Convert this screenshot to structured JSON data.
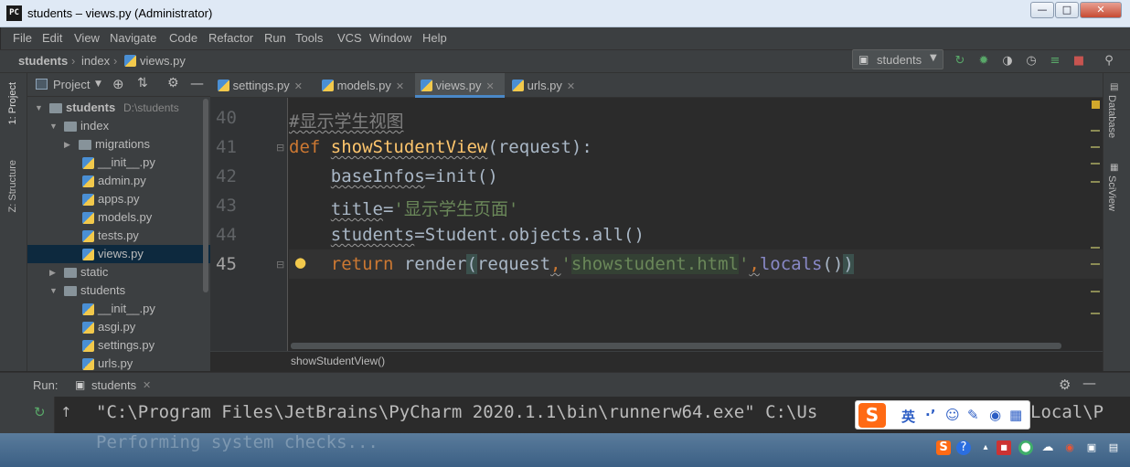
{
  "window": {
    "title": "students – views.py (Administrator)",
    "logo": "PC"
  },
  "menu": [
    "File",
    "Edit",
    "View",
    "Navigate",
    "Code",
    "Refactor",
    "Run",
    "Tools",
    "VCS",
    "Window",
    "Help"
  ],
  "breadcrumbs": [
    "students",
    "index",
    "views.py"
  ],
  "run_config": {
    "label": "students"
  },
  "left_tabs": {
    "project": "1: Project",
    "structure": "Z: Structure"
  },
  "right_tabs": {
    "database": "Database",
    "sciview": "SciView"
  },
  "project_panel": {
    "header": "Project",
    "tree": [
      {
        "label": "students",
        "hint": "D:\\students",
        "depth": 0,
        "type": "folder",
        "open": true
      },
      {
        "label": "index",
        "depth": 1,
        "type": "folder",
        "open": true
      },
      {
        "label": "migrations",
        "depth": 2,
        "type": "folder",
        "open": false
      },
      {
        "label": "__init__.py",
        "depth": 3,
        "type": "py"
      },
      {
        "label": "admin.py",
        "depth": 3,
        "type": "py"
      },
      {
        "label": "apps.py",
        "depth": 3,
        "type": "py"
      },
      {
        "label": "models.py",
        "depth": 3,
        "type": "py"
      },
      {
        "label": "tests.py",
        "depth": 3,
        "type": "py"
      },
      {
        "label": "views.py",
        "depth": 3,
        "type": "py",
        "selected": true
      },
      {
        "label": "static",
        "depth": 1,
        "type": "folder",
        "open": false
      },
      {
        "label": "students",
        "depth": 1,
        "type": "folder",
        "open": true
      },
      {
        "label": "__init__.py",
        "depth": 3,
        "type": "py"
      },
      {
        "label": "asgi.py",
        "depth": 3,
        "type": "py"
      },
      {
        "label": "settings.py",
        "depth": 3,
        "type": "py"
      },
      {
        "label": "urls.py",
        "depth": 3,
        "type": "py"
      }
    ]
  },
  "tabs": [
    {
      "label": "settings.py",
      "active": false
    },
    {
      "label": "models.py",
      "active": false
    },
    {
      "label": "views.py",
      "active": true
    },
    {
      "label": "urls.py",
      "active": false
    }
  ],
  "editor": {
    "line_numbers": [
      "40",
      "41",
      "42",
      "43",
      "44",
      "45"
    ],
    "lines": {
      "l40": {
        "comment": "#显示学生视图"
      },
      "l41": {
        "kw": "def",
        "fn": "showStudentView",
        "rest": "(request):"
      },
      "l42": {
        "var": "baseInfos",
        "rest": "=init()"
      },
      "l43": {
        "var": "title",
        "eq": "=",
        "str": "'显示学生页面'"
      },
      "l44": {
        "var": "students",
        "rest": "=Student.objects.all()"
      },
      "l45": {
        "kw": "return",
        "call": " render",
        "open": "(",
        "arg": "request",
        "comma": ",",
        "q1": "'",
        "str": "showstudent.html",
        "q2": "'",
        "comma2": ",",
        "bi": "locals",
        "paren": "()",
        "close": ")"
      }
    },
    "breadcrumb": "showStudentView()"
  },
  "run_panel": {
    "label": "Run:",
    "tab": "students",
    "command": "\"C:\\Program Files\\JetBrains\\PyCharm 2020.1.1\\bin\\runnerw64.exe\" C:\\Us",
    "command_tail": "Local\\P",
    "faded": "Performing system checks..."
  },
  "ime": {
    "logo": "S",
    "mode": "英",
    "punct": "·’"
  }
}
